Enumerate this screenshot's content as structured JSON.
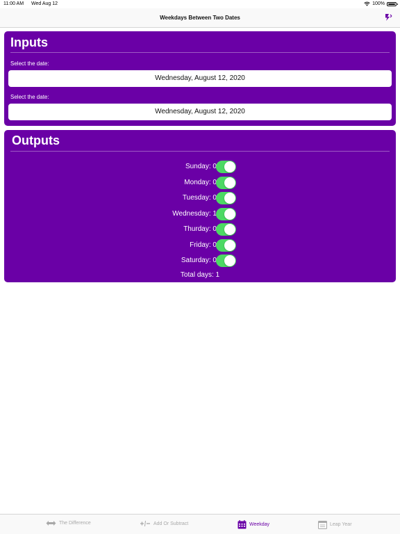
{
  "status_bar": {
    "time": "11:00 AM",
    "date": "Wed Aug 12",
    "battery": "100%"
  },
  "nav": {
    "title": "Weekdays Between Two Dates"
  },
  "inputs": {
    "title": "Inputs",
    "fields": [
      {
        "label": "Select the date:",
        "value": "Wednesday, August 12, 2020"
      },
      {
        "label": "Select the date:",
        "value": "Wednesday, August 12, 2020"
      }
    ]
  },
  "outputs": {
    "title": "Outputs",
    "days": [
      {
        "label": "Sunday:  0",
        "on": true
      },
      {
        "label": "Monday:  0",
        "on": true
      },
      {
        "label": "Tuesday:  0",
        "on": true
      },
      {
        "label": "Wednesday:  1",
        "on": true
      },
      {
        "label": "Thurday:  0",
        "on": true
      },
      {
        "label": "Friday:  0",
        "on": true
      },
      {
        "label": "Saturday:  0",
        "on": true
      }
    ],
    "total": "Total days: 1"
  },
  "tabs": [
    {
      "label": "The Difference",
      "icon": "double-arrow-icon",
      "active": false
    },
    {
      "label": "Add Or Subtract",
      "icon": "plus-minus-icon",
      "active": false
    },
    {
      "label": "Weekday",
      "icon": "calendar-grid-icon",
      "active": true
    },
    {
      "label": "Leap Year",
      "icon": "calendar-icon",
      "active": false
    }
  ],
  "colors": {
    "accent": "#6a00a6",
    "toggle_on": "#4cd964",
    "tab_inactive": "#a8a8a8"
  }
}
